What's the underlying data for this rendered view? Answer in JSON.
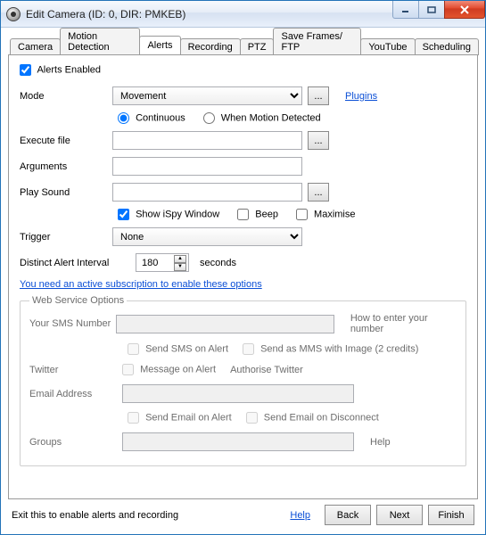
{
  "window": {
    "title": "Edit Camera (ID: 0, DIR: PMKEB)"
  },
  "tabs": [
    "Camera",
    "Motion Detection",
    "Alerts",
    "Recording",
    "PTZ",
    "Save Frames/ FTP",
    "YouTube",
    "Scheduling"
  ],
  "active_tab": "Alerts",
  "alerts": {
    "enabled_label": "Alerts Enabled",
    "enabled": true,
    "mode_label": "Mode",
    "mode_value": "Movement",
    "browse_label": "...",
    "plugins_link": "Plugins",
    "radio_continuous": "Continuous",
    "radio_when_motion": "When Motion Detected",
    "radio_selected": "continuous",
    "exec_label": "Execute file",
    "exec_value": "",
    "args_label": "Arguments",
    "args_value": "",
    "sound_label": "Play Sound",
    "sound_value": "",
    "show_ispy_label": "Show iSpy Window",
    "show_ispy": true,
    "beep_label": "Beep",
    "beep": false,
    "maximise_label": "Maximise",
    "maximise": false,
    "trigger_label": "Trigger",
    "trigger_value": "None",
    "interval_label": "Distinct Alert Interval",
    "interval_value": "180",
    "interval_unit": "seconds",
    "subscription_link": "You need an active subscription to enable these options"
  },
  "ws": {
    "legend": "Web Service Options",
    "sms_label": "Your SMS Number",
    "sms_value": "",
    "howto_label": "How to enter your number",
    "send_sms_label": "Send SMS on Alert",
    "send_mms_label": "Send as MMS with Image (2 credits)",
    "twitter_label": "Twitter",
    "msg_alert_label": "Message on Alert",
    "auth_twitter_label": "Authorise Twitter",
    "email_label": "Email Address",
    "email_value": "",
    "send_email_alert_label": "Send Email on Alert",
    "send_email_disc_label": "Send Email on Disconnect",
    "groups_label": "Groups",
    "groups_value": "",
    "help_label": "Help"
  },
  "footer": {
    "hint": "Exit this to enable alerts and recording",
    "help": "Help",
    "back": "Back",
    "next": "Next",
    "finish": "Finish"
  }
}
